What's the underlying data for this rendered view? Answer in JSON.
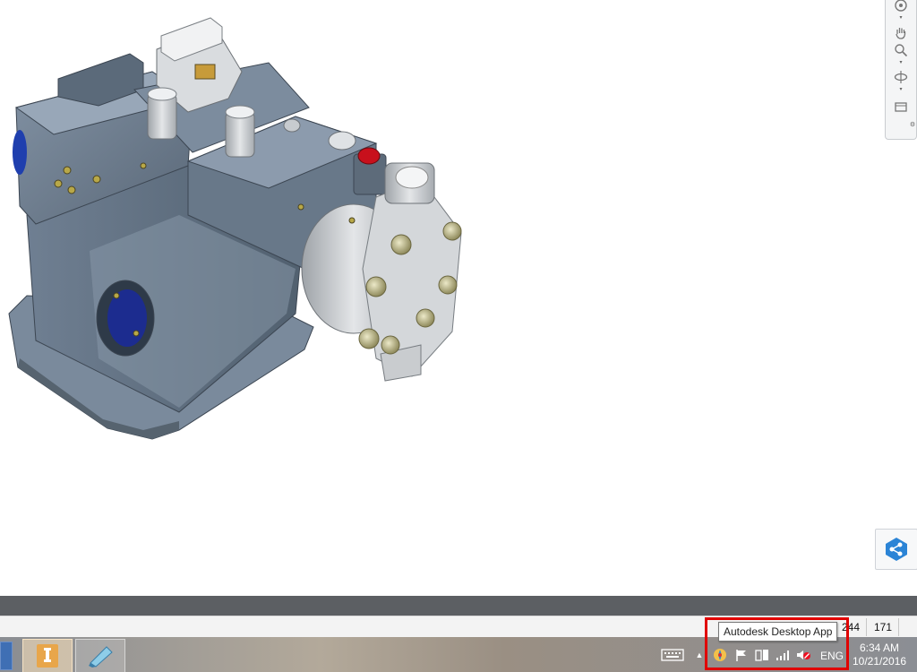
{
  "status": {
    "num_a": "244",
    "num_b": "171"
  },
  "tooltip": {
    "text": "Autodesk Desktop App"
  },
  "taskbar": {
    "items": [
      {
        "icon": "inventor-pro-icon",
        "active": true
      },
      {
        "icon": "file-explorer-icon",
        "active": false
      }
    ],
    "tray": {
      "icons": [
        "keyboard-icon",
        "show-hidden-arrow-icon",
        "autodesk-desktop-app-icon",
        "flag-icon",
        "network-icon",
        "signal-icon",
        "volume-muted-icon"
      ],
      "language": "ENG"
    },
    "clock": {
      "time": "6:34 AM",
      "date": "10/21/2016"
    }
  },
  "navbar": {
    "tools": [
      "steering-wheel-icon",
      "pan-icon",
      "zoom-icon",
      "orbit-icon",
      "view-face-icon"
    ]
  },
  "colors": {
    "model_body": "#6e7e91",
    "model_dark": "#4a5663",
    "model_light": "#95a4b5",
    "highlight": "#e00000",
    "share_blue": "#2b84d6"
  }
}
